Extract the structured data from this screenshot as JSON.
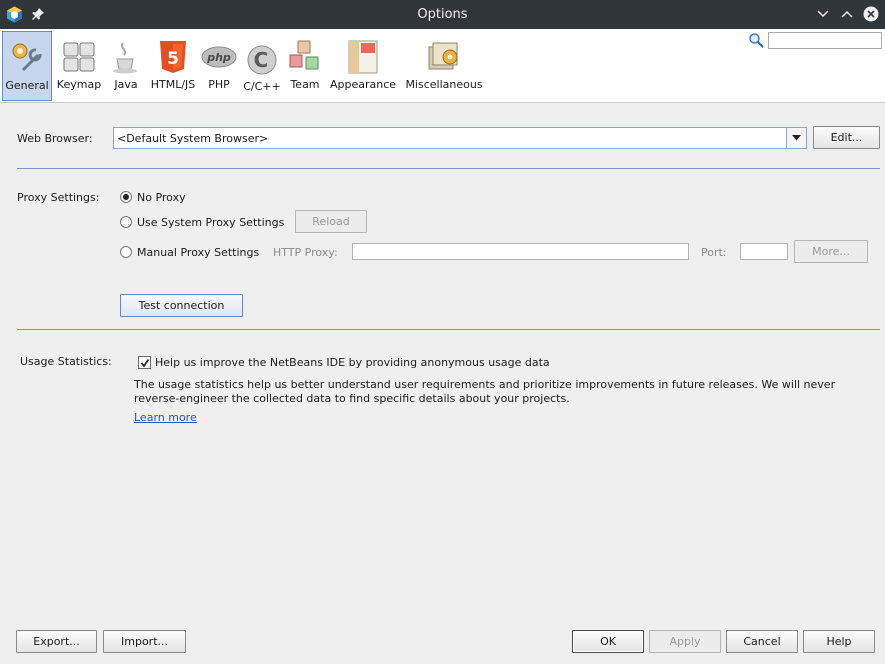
{
  "window": {
    "title": "Options"
  },
  "toolbar": {
    "categories": [
      {
        "label": "General",
        "icon": "general-icon",
        "selected": true
      },
      {
        "label": "Keymap",
        "icon": "keymap-icon"
      },
      {
        "label": "Java",
        "icon": "java-icon"
      },
      {
        "label": "HTML/JS",
        "icon": "html5-icon"
      },
      {
        "label": "PHP",
        "icon": "php-icon"
      },
      {
        "label": "C/C++",
        "icon": "cpp-icon"
      },
      {
        "label": "Team",
        "icon": "team-icon"
      },
      {
        "label": "Appearance",
        "icon": "appearance-icon"
      },
      {
        "label": "Miscellaneous",
        "icon": "miscellaneous-icon"
      }
    ],
    "search": {
      "value": "",
      "icon": "search-icon"
    }
  },
  "web_browser": {
    "label": "Web Browser:",
    "value": "<Default System Browser>",
    "edit_label": "Edit..."
  },
  "proxy": {
    "label": "Proxy Settings:",
    "no_proxy": "No Proxy",
    "system_proxy": "Use System Proxy Settings",
    "reload_label": "Reload",
    "manual_proxy": "Manual Proxy Settings",
    "http_proxy_label": "HTTP Proxy:",
    "http_proxy_value": "",
    "port_label": "Port:",
    "port_value": "",
    "more_label": "More...",
    "test_connection_label": "Test connection",
    "selected": "no_proxy"
  },
  "usage": {
    "label": "Usage Statistics:",
    "checkbox_label": "Help us improve the NetBeans IDE by providing anonymous usage data",
    "checked": true,
    "description": "The usage statistics help us better understand user requirements and prioritize improvements in future releases. We will never reverse-engineer the collected data to find specific details about your projects.",
    "learn_more": "Learn more"
  },
  "footer": {
    "export_label": "Export...",
    "import_label": "Import...",
    "ok_label": "OK",
    "apply_label": "Apply",
    "cancel_label": "Cancel",
    "help_label": "Help"
  },
  "colors": {
    "titlebar": "#31363b",
    "selection": "#c7d6ec",
    "separator": "#7f96bf",
    "link": "#2a4fc7"
  }
}
